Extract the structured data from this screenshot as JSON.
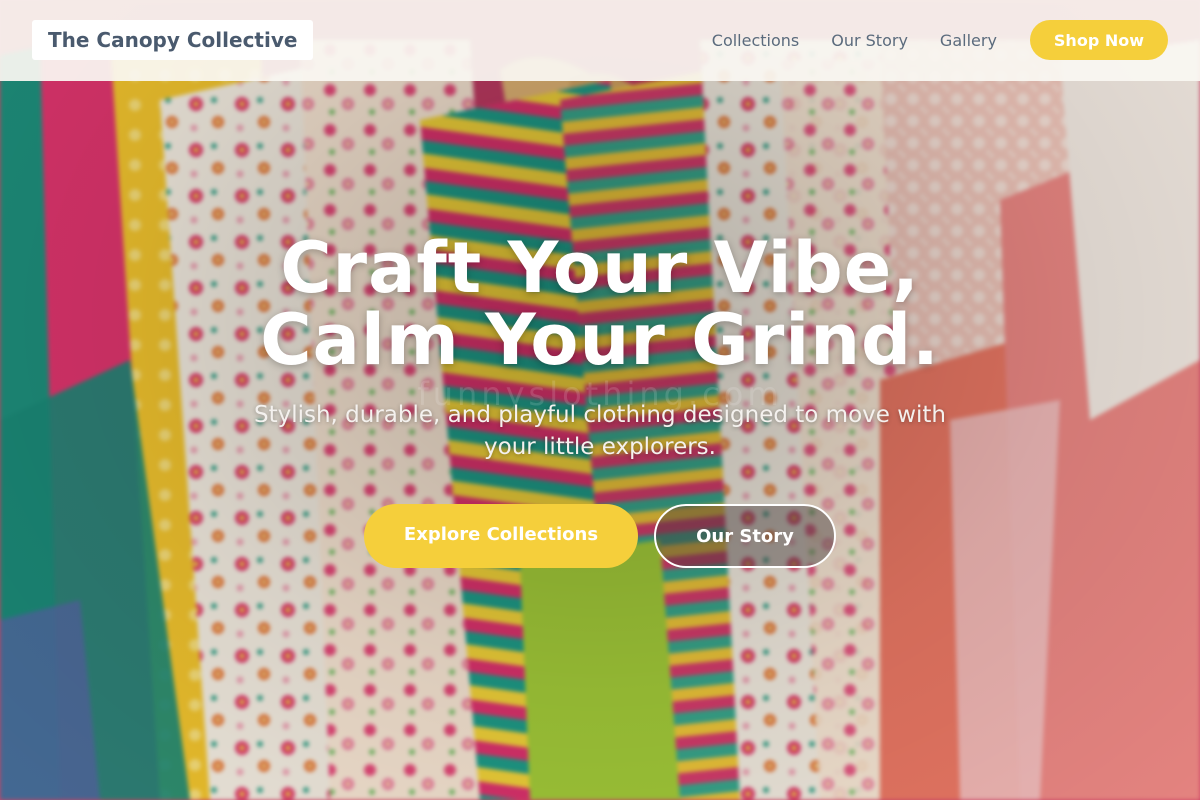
{
  "header": {
    "brand": "The Canopy Collective",
    "nav": [
      "Collections",
      "Our Story",
      "Gallery"
    ],
    "cta": "Shop Now"
  },
  "hero": {
    "headline_line1": "Craft Your Vibe,",
    "headline_line2": "Calm Your Grind.",
    "subheadline": "Stylish, durable, and playful clothing designed to move with your little explorers.",
    "watermark": "funnyslothing.com",
    "primary_button": "Explore Collections",
    "secondary_button": "Our Story",
    "background": "clothing-rack-photo"
  },
  "colors": {
    "accent": "#f5cf3b",
    "brand_text": "#4a5a6e",
    "nav_text": "#5b6b7d"
  }
}
